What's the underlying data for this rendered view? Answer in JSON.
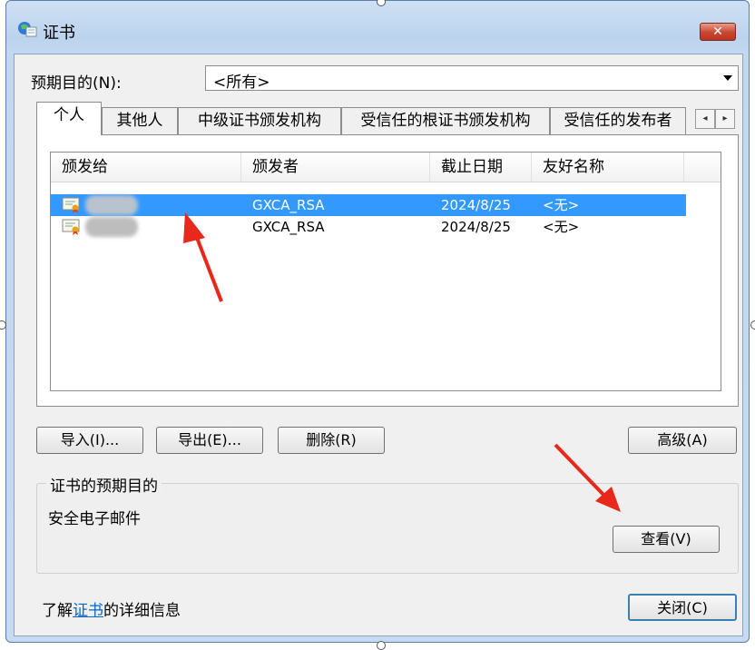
{
  "window": {
    "title": "证书",
    "close_label": "✕"
  },
  "purpose": {
    "label": "预期目的(N):",
    "selected": "<所有>"
  },
  "tabs": [
    {
      "label": "个人"
    },
    {
      "label": "其他人"
    },
    {
      "label": "中级证书颁发机构"
    },
    {
      "label": "受信任的根证书颁发机构"
    },
    {
      "label": "受信任的发布者"
    }
  ],
  "tab_scroll": {
    "left": "◂",
    "right": "▸"
  },
  "list": {
    "columns": [
      "颁发给",
      "颁发者",
      "截止日期",
      "友好名称"
    ],
    "rows": [
      {
        "issued_by": "GXCA_RSA",
        "expires": "2024/8/25",
        "friendly": "<无>",
        "selected": true
      },
      {
        "issued_by": "GXCA_RSA",
        "expires": "2024/8/25",
        "friendly": "<无>",
        "selected": false
      }
    ]
  },
  "buttons": {
    "import": "导入(I)...",
    "export": "导出(E)...",
    "delete": "删除(R)",
    "advanced": "高级(A)",
    "view": "查看(V)",
    "close": "关闭(C)"
  },
  "purposes_group": {
    "title": "证书的预期目的",
    "text": "安全电子邮件"
  },
  "footer": {
    "prefix": "了解",
    "link": "证书",
    "suffix": "的详细信息"
  },
  "colors": {
    "selection": "#3399ff",
    "annotation_arrow": "#e8281a",
    "link": "#0066cc"
  }
}
